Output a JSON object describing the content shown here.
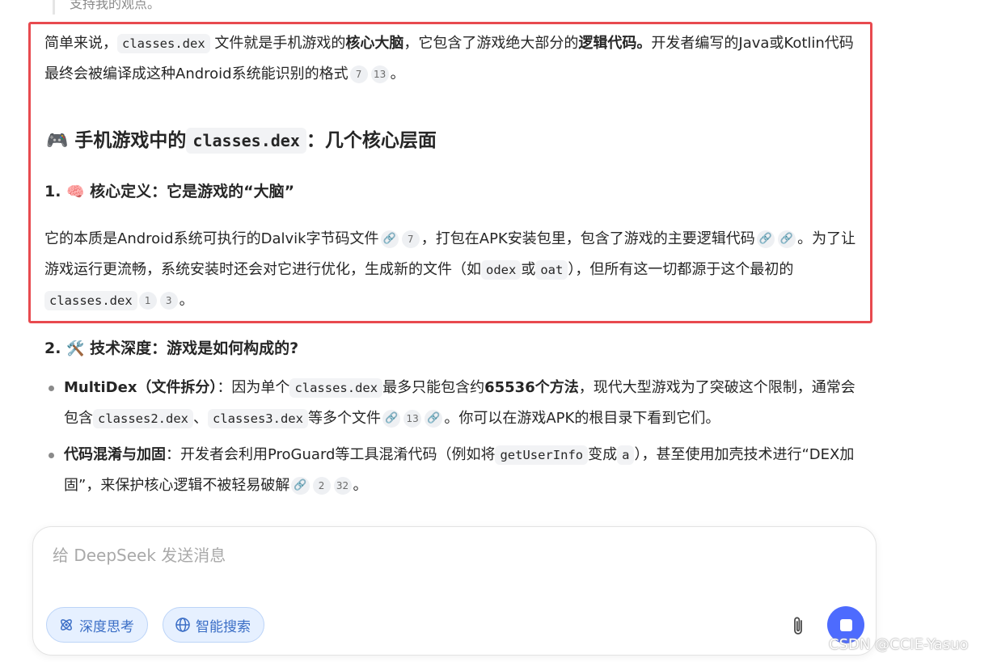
{
  "prev_text": "支持我的观点。",
  "intro": {
    "a": "简单来说，",
    "code1": "classes.dex",
    "b": " 文件就是手机游戏的",
    "bold1": "核心大脑",
    "c": "，它包含了游戏绝大部分的",
    "bold2": "逻辑代码。",
    "d": "开发者编写的Java或Kotlin代码最终会被编译成这种Android系统能识别的格式",
    "cite1": "7",
    "cite2": "13",
    "end": "。"
  },
  "heading": {
    "emoji": "🎮",
    "pre": "手机游戏中的",
    "code": "classes.dex",
    "post": "：几个核心层面"
  },
  "section1": {
    "number": "1.",
    "emoji": "🧠",
    "title": "核心定义：它是游戏的“大脑”",
    "a": "它的本质是Android系统可执行的Dalvik字节码文件",
    "cite1": "7",
    "b": "，打包在APK安装包里，包含了游戏的主要逻辑代码",
    "c": "。为了让游戏运行更流畅，系统安装时还会对它进行优化，生成新的文件（如",
    "code1": "odex",
    "or": "或",
    "code2": "oat",
    "d": "），但所有这一切都源于这个最初的",
    "code3": "classes.dex",
    "cite2": "1",
    "cite3": "3",
    "end": "。"
  },
  "section2": {
    "number": "2.",
    "emoji": "🛠️",
    "title": "技术深度：游戏是如何构成的?",
    "bullet1": {
      "bold": "MultiDex（文件拆分）",
      "a": "：因为单个",
      "code1": "classes.dex",
      "b": "最多只能包含约",
      "bold2": "65536个方法",
      "c": "，现代大型游戏为了突破这个限制，通常会包含",
      "code2": "classes2.dex",
      "sep": "、",
      "code3": "classes3.dex",
      "d": "等多个文件",
      "cite1": "13",
      "e": "。你可以在游戏APK的根目录下看到它们。"
    },
    "bullet2": {
      "bold": "代码混淆与加固",
      "a": "：开发者会利用ProGuard等工具混淆代码（例如将",
      "code1": "getUserInfo",
      "b": "变成",
      "code2": "a",
      "c": "），甚至使用加壳技术进行“DEX加固”，来保护核心逻辑不被轻易破解",
      "cite1": "2",
      "cite2": "32",
      "end": "。"
    }
  },
  "composer": {
    "placeholder": "给 DeepSeek 发送消息",
    "deep_think": "深度思考",
    "web_search": "智能搜索"
  },
  "watermark": "CSDN @CCIE-Yasuo",
  "colors": {
    "accent": "#4d6bfe",
    "highlight_border": "#e84a4f",
    "pill_bg": "#e6f0ff",
    "pill_text": "#3b6ec6"
  },
  "icons": {
    "citation_link": "link-icon",
    "deep_think": "atom-icon",
    "web_search": "globe-icon",
    "attach": "paperclip-icon",
    "send": "stop-icon"
  }
}
